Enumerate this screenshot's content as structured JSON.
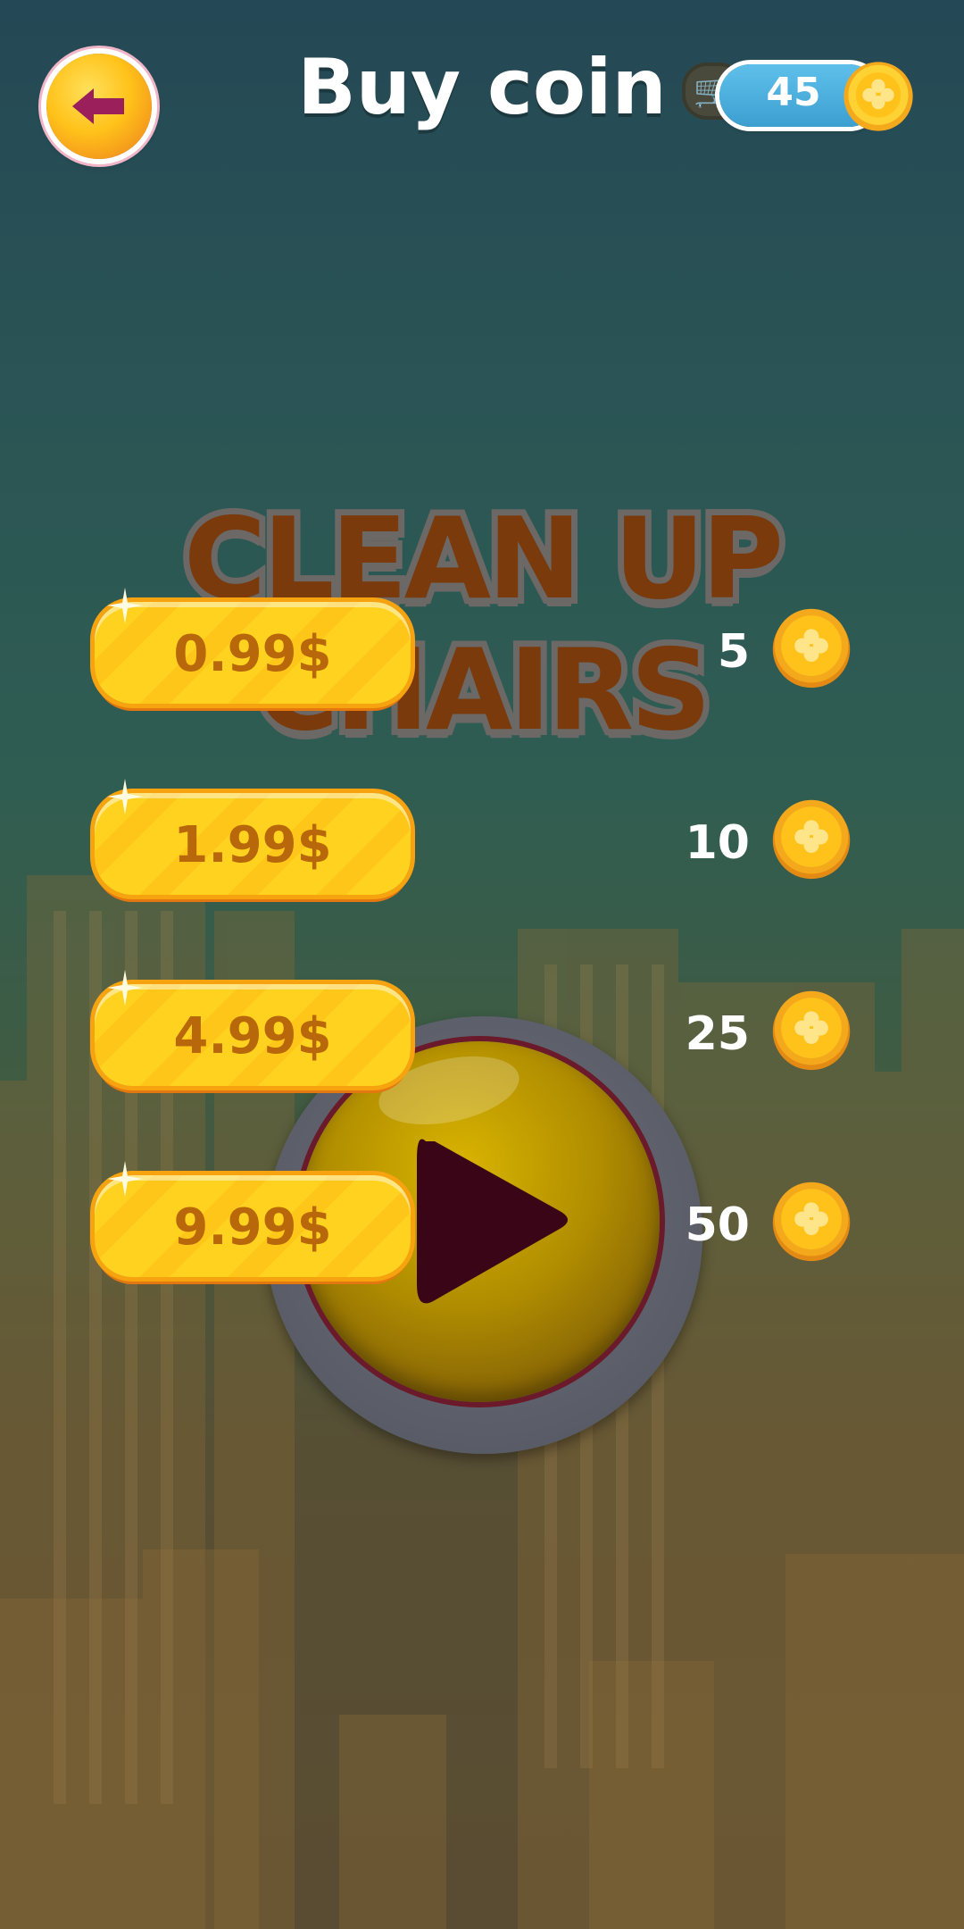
{
  "header": {
    "title": "Buy coin",
    "coin_balance": "45"
  },
  "game_title": "CLEAN UP CHAIRS",
  "offers": [
    {
      "price": "0.99$",
      "coins": "5"
    },
    {
      "price": "1.99$",
      "coins": "10"
    },
    {
      "price": "4.99$",
      "coins": "25"
    },
    {
      "price": "9.99$",
      "coins": "50"
    }
  ],
  "icons": {
    "back": "back-arrow-icon",
    "cart": "cart-icon",
    "coin": "coin-icon",
    "play": "play-icon"
  },
  "colors": {
    "price_button": "#ffd21f",
    "price_text": "#b8670a",
    "counter_pill": "#3d9fd0",
    "title_fill": "#7a3a0c"
  }
}
